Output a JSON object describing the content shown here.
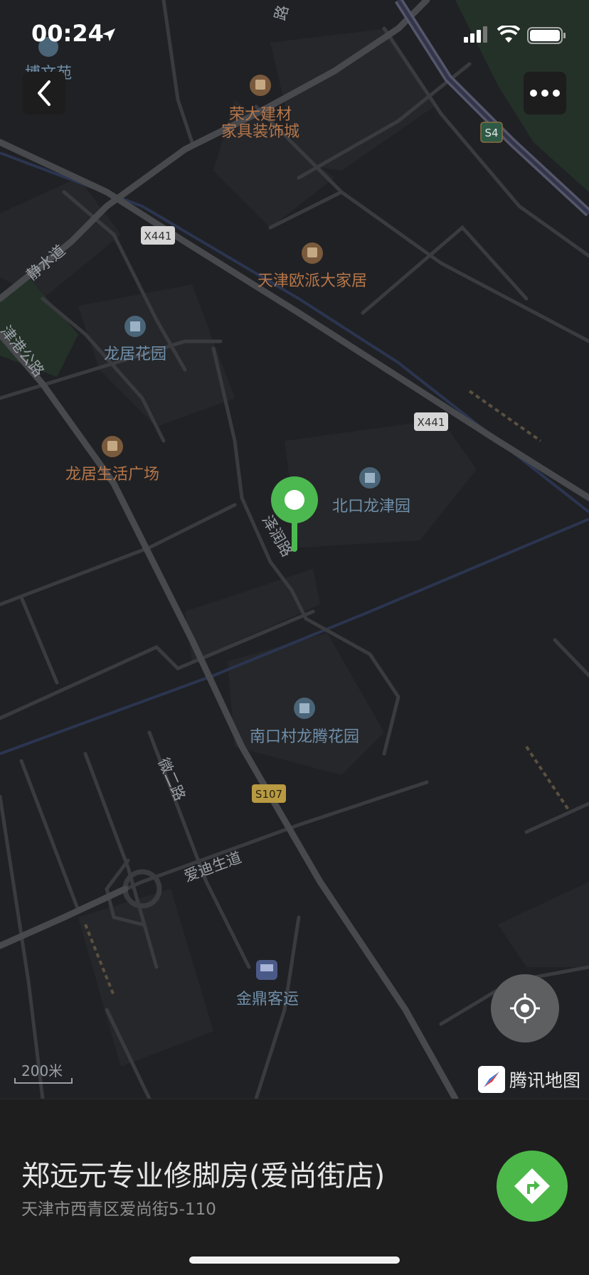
{
  "status_bar": {
    "time": "00:24"
  },
  "map": {
    "background": "#202124",
    "pois": [
      {
        "name": "博文苑",
        "kind": "residential"
      },
      {
        "name_line1": "荣大建材",
        "name_line2": "家具装饰城",
        "kind": "shopping"
      },
      {
        "name": "天津欧派大家居",
        "kind": "shopping"
      },
      {
        "name": "龙居花园",
        "kind": "residential"
      },
      {
        "name": "龙居生活广场",
        "kind": "shopping"
      },
      {
        "name": "北口龙津园",
        "kind": "residential"
      },
      {
        "name": "南口村龙腾花园",
        "kind": "residential"
      },
      {
        "name": "金鼎客运",
        "kind": "bus-station"
      }
    ],
    "roads": [
      "静水道",
      "津港公路",
      "泽润路",
      "微二路",
      "爱迪生道"
    ],
    "top_road_fragment": "路",
    "shields": [
      "S4",
      "X441",
      "X441",
      "S107"
    ],
    "marker_color": "#4cb850",
    "scale_label": "200米",
    "brand": "腾讯地图"
  },
  "place": {
    "name": "郑远元专业修脚房(爱尚街店)",
    "address": "天津市西青区爱尚街5-110"
  },
  "colors": {
    "accent_green": "#4db84a",
    "poi_brown": "#b5764a",
    "poi_blue": "#6f8faa"
  }
}
